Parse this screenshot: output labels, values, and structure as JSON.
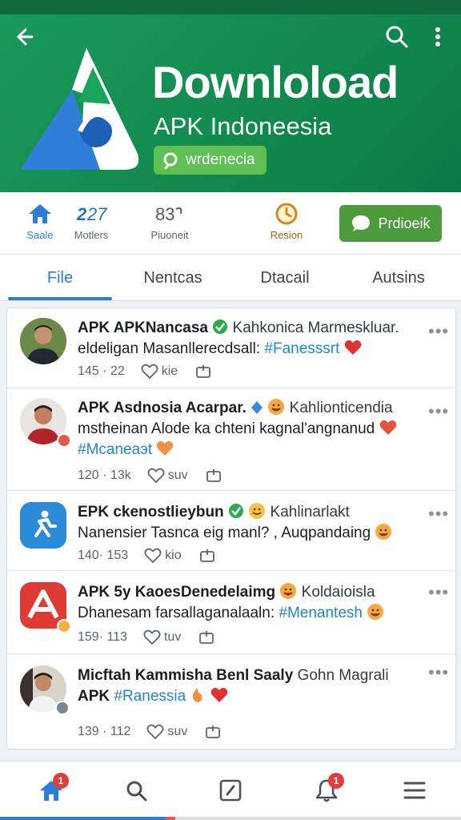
{
  "header": {
    "title": "Downloload",
    "subtitle": "APK Indoneesia",
    "chip_label": "wrdenecia"
  },
  "actions": {
    "items": [
      {
        "label": "Saale",
        "icon": "home-icon"
      },
      {
        "label": "Motlers",
        "icon": "mobile-247-icon"
      },
      {
        "label": "Piuoneit",
        "icon": "infinity-icon"
      },
      {
        "label": "Resion",
        "icon": "clock-icon"
      }
    ],
    "button_label": "Prdioeiƙ"
  },
  "tabs": [
    {
      "label": "File",
      "active": true
    },
    {
      "label": "Nentcas"
    },
    {
      "label": "Dtacail"
    },
    {
      "label": "Autsins"
    }
  ],
  "posts": [
    {
      "name": "APK APKNancasa",
      "sub": "Kahkonica Marmeskluar.",
      "line2": "eldeligan Masanllerecdsall:",
      "hashtag": "#Fanesssrt",
      "stat1": "145 · 22",
      "like_label": "kie"
    },
    {
      "name": "APK Asdnosia Acarpar.",
      "sub": "Kahlionticendia",
      "line2": "msthеinan Alode ka chteni kagnal'angnanud",
      "hashtag": "#Mcaneaэt",
      "stat1": "120 · 13k",
      "like_label": "suv"
    },
    {
      "name": "EPK ckenostlieybun",
      "sub": "Kahlinarlakt",
      "line2": "Nanensier Tasnca eig manl? , Auqpandaing",
      "stat1": "140· 153",
      "like_label": "kio"
    },
    {
      "name": "APK 5y KaoesDenedelaimg",
      "sub": "Koldaioisla",
      "line2": "Dhanesam farsallaganalaaln:",
      "hashtag": "#Menantesh",
      "stat1": "159· 113",
      "like_label": "tuv"
    },
    {
      "name": "Micftah Kammisha Benl Saaly",
      "sub": "Gohn Magrali",
      "line2": "APK",
      "hashtag": "#Ranessia",
      "stat1": "139 · 112",
      "like_label": "suv"
    }
  ],
  "bottom_nav": {
    "home_badge": "1",
    "notif_badge": "1"
  },
  "colors": {
    "brand_green": "#118a4e",
    "accent_blue": "#2a7fd4",
    "heart_red": "#e0302f"
  }
}
